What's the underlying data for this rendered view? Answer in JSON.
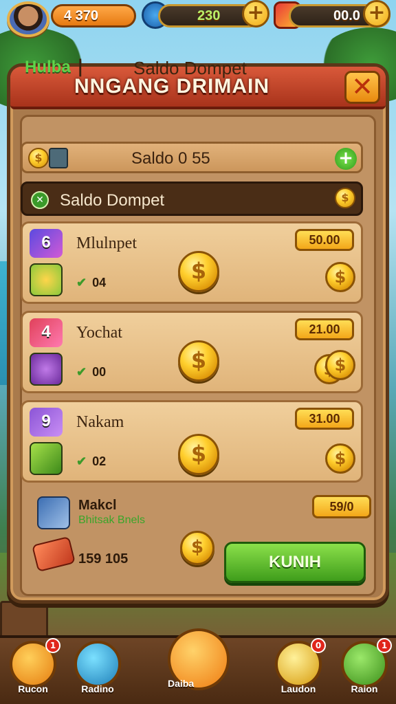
{
  "hud": {
    "level_value": "4 370",
    "gems_value": "230",
    "currency_value": "00.0",
    "plus_label": "+"
  },
  "panel": {
    "title": "NNGANG DRIMAIN",
    "close_label": "✕"
  },
  "header": {
    "tab_label": "Hulba",
    "separator": "|",
    "title": "Saldo Dompet"
  },
  "saldo_bar": {
    "label": "Saldo 0 55",
    "plus_label": "+"
  },
  "wallet_bar": {
    "badge": "✕",
    "label": "Saldo Dompet"
  },
  "cards": [
    {
      "num": "6",
      "name": "Mlulnpet",
      "small": "04",
      "price": "50.00",
      "num_color": "#5b4ae0",
      "icon_color": "#8ac93c"
    },
    {
      "num": "4",
      "name": "Yochat",
      "small": "00",
      "price": "21.00",
      "num_color": "#e0415a",
      "icon_color": "#8b3ab8"
    },
    {
      "num": "9",
      "name": "Nakam",
      "small": "02",
      "price": "31.00",
      "num_color": "#8b55d6",
      "icon_color": "#6cbc2e"
    }
  ],
  "bottom_offer": {
    "title": "Makcl",
    "subtitle": "Bhitsak Bnels",
    "price": "59/0",
    "balance": "159 105",
    "buy_label": "KUNIH"
  },
  "nav": {
    "items": [
      {
        "label": "Rucon",
        "badge": "1",
        "icon": "toolbox-icon"
      },
      {
        "label": "Radino",
        "badge": "",
        "icon": "magnifier-icon"
      },
      {
        "label": "Daiba",
        "badge": "",
        "icon": "home-icon"
      },
      {
        "label": "Laudon",
        "badge": "0",
        "icon": "coin-icon"
      },
      {
        "label": "Raion",
        "badge": "1",
        "icon": "menu-icon"
      }
    ]
  },
  "colors": {
    "panel_bg": "#a97a4c",
    "title_bar": "#c4432a",
    "accent_gold": "#f3a914",
    "buy_green": "#5bbf2a"
  }
}
